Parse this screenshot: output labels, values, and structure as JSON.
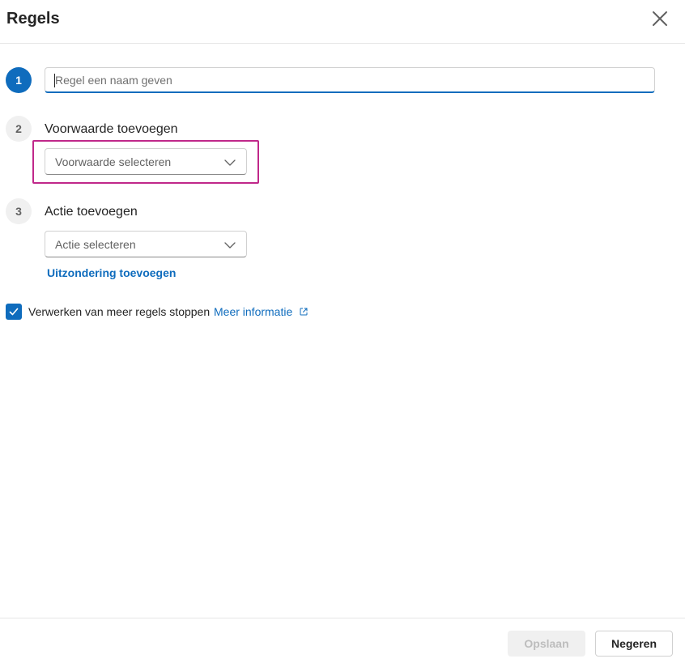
{
  "dialog": {
    "title": "Regels",
    "close_icon": "close-icon"
  },
  "steps": [
    {
      "number": "1",
      "input_placeholder": "Regel een naam geven",
      "input_value": ""
    },
    {
      "number": "2",
      "label": "Voorwaarde toevoegen",
      "dropdown_value": "Voorwaarde selecteren"
    },
    {
      "number": "3",
      "label": "Actie toevoegen",
      "dropdown_value": "Actie selecteren",
      "exception_link": "Uitzondering toevoegen"
    }
  ],
  "stop_processing": {
    "checked": true,
    "label": "Verwerken van meer regels stoppen",
    "more_info_link": "Meer informatie"
  },
  "footer": {
    "save_label": "Opslaan",
    "save_disabled": true,
    "ignore_label": "Negeren"
  },
  "colors": {
    "accent": "#0f6cbd",
    "highlight": "#c0288a"
  }
}
